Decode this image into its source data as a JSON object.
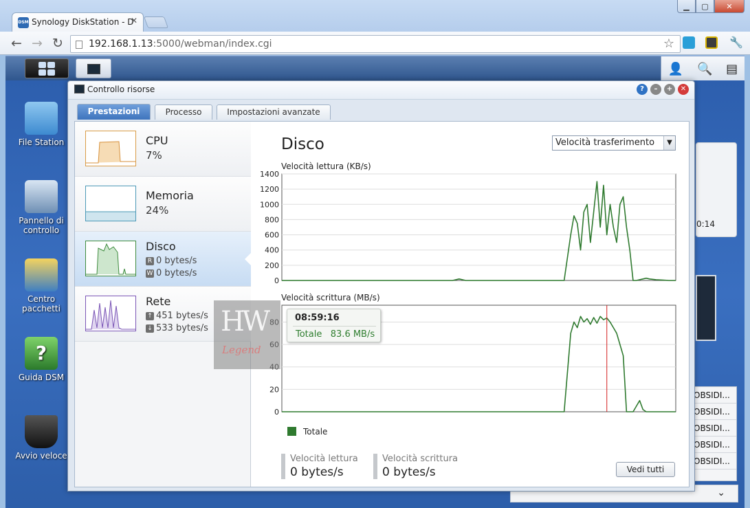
{
  "browser": {
    "tab_title": "Synology DiskStation - DiskSt",
    "url_host": "192.168.1.13",
    "url_rest": ":5000/webman/index.cgi"
  },
  "desktop": {
    "icons": [
      {
        "label": "File Station"
      },
      {
        "label": "Pannello di controllo"
      },
      {
        "label": "Centro pacchetti"
      },
      {
        "label": "Guida DSM"
      },
      {
        "label": "Avvio veloce"
      }
    ],
    "widget_clock_fragment": "0:14",
    "widget_list": [
      "OBSIDI...",
      "OBSIDI...",
      "OBSIDI...",
      "OBSIDI...",
      "OBSIDI..."
    ]
  },
  "window": {
    "title": "Controllo risorse",
    "tabs": [
      "Prestazioni",
      "Processo",
      "Impostazioni avanzate"
    ],
    "items": {
      "cpu": {
        "name": "CPU",
        "value": "7%"
      },
      "memory": {
        "name": "Memoria",
        "value": "24%"
      },
      "disk": {
        "name": "Disco",
        "read_badge": "R",
        "read": "0 bytes/s",
        "write_badge": "W",
        "write": "0 bytes/s"
      },
      "network": {
        "name": "Rete",
        "up": "451 bytes/s",
        "down": "533 bytes/s"
      }
    },
    "detail": {
      "title": "Disco",
      "select_value": "Velocità trasferimento",
      "read_chart_label": "Velocità lettura (KB/s)",
      "write_chart_label": "Velocità scrittura (MB/s)",
      "legend": "Totale",
      "tooltip": {
        "time": "08:59:16",
        "series": "Totale",
        "value": "83.6 MB/s"
      },
      "stat_read_label": "Velocità lettura",
      "stat_read_value": "0 bytes/s",
      "stat_write_label": "Velocità scrittura",
      "stat_write_value": "0 bytes/s",
      "view_all": "Vedi tutti"
    }
  },
  "colors": {
    "series": "#2f7a2f",
    "cursor": "#d42020"
  },
  "chart_data": [
    {
      "type": "line",
      "title": "Velocità lettura (KB/s)",
      "ylabel": "KB/s",
      "ylim": [
        0,
        1400
      ],
      "yticks": [
        0,
        200,
        400,
        600,
        800,
        1000,
        1200,
        1400
      ],
      "grid": true,
      "series": [
        {
          "name": "Totale",
          "x": [
            0,
            52,
            54,
            55,
            56,
            62,
            82,
            86,
            88,
            89,
            90,
            91,
            92,
            93,
            94,
            95,
            96,
            97,
            98,
            99,
            100,
            101,
            102,
            103,
            104,
            105,
            106,
            107,
            108,
            109,
            110,
            111,
            112,
            114,
            116,
            118,
            120
          ],
          "values": [
            0,
            0,
            20,
            10,
            0,
            0,
            0,
            0,
            600,
            850,
            750,
            400,
            900,
            1000,
            500,
            900,
            1300,
            700,
            1250,
            600,
            1000,
            700,
            500,
            1000,
            1100,
            700,
            400,
            0,
            0,
            10,
            20,
            30,
            20,
            10,
            5,
            0,
            0
          ]
        }
      ]
    },
    {
      "type": "line",
      "title": "Velocità scrittura (MB/s)",
      "ylabel": "MB/s",
      "ylim": [
        0,
        90
      ],
      "yticks": [
        0,
        20,
        40,
        60,
        80
      ],
      "grid": true,
      "series": [
        {
          "name": "Totale",
          "x": [
            0,
            78,
            86,
            88,
            89,
            90,
            91,
            92,
            93,
            94,
            95,
            96,
            97,
            98,
            99,
            100,
            101,
            102,
            103,
            104,
            105,
            106,
            107,
            108,
            109,
            110,
            111,
            112,
            113,
            114,
            116,
            120
          ],
          "values": [
            0,
            0,
            0,
            70,
            80,
            75,
            85,
            80,
            83,
            78,
            84,
            79,
            85,
            82,
            83.6,
            80,
            75,
            70,
            60,
            50,
            0,
            0,
            0,
            5,
            10,
            2,
            0,
            0,
            0,
            0,
            0,
            0
          ]
        }
      ],
      "cursor_x": 99
    }
  ]
}
